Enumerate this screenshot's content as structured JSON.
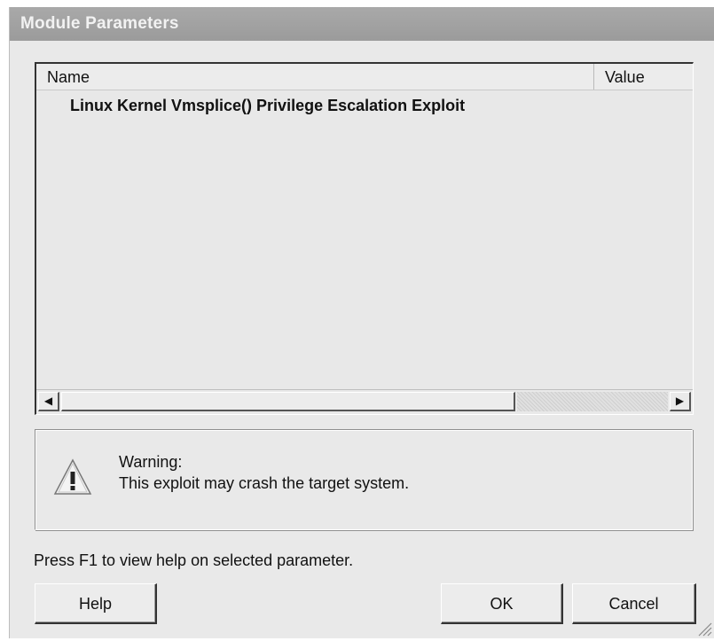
{
  "window": {
    "title": "Module Parameters"
  },
  "table": {
    "columns": {
      "name": "Name",
      "value": "Value"
    },
    "rows": [
      {
        "name": "Linux Kernel Vmsplice() Privilege Escalation Exploit",
        "value": ""
      }
    ]
  },
  "scrollbar": {
    "left_arrow": "◀",
    "right_arrow": "▶"
  },
  "warning": {
    "icon": "warning-triangle-icon",
    "title": "Warning:",
    "message": "This exploit may crash the target system."
  },
  "help_text": "Press F1 to view help on selected parameter.",
  "buttons": {
    "help": "Help",
    "ok": "OK",
    "cancel": "Cancel"
  },
  "colors": {
    "titlebar": "#a3a3a3",
    "dialog_bg": "#e9e9e9"
  }
}
